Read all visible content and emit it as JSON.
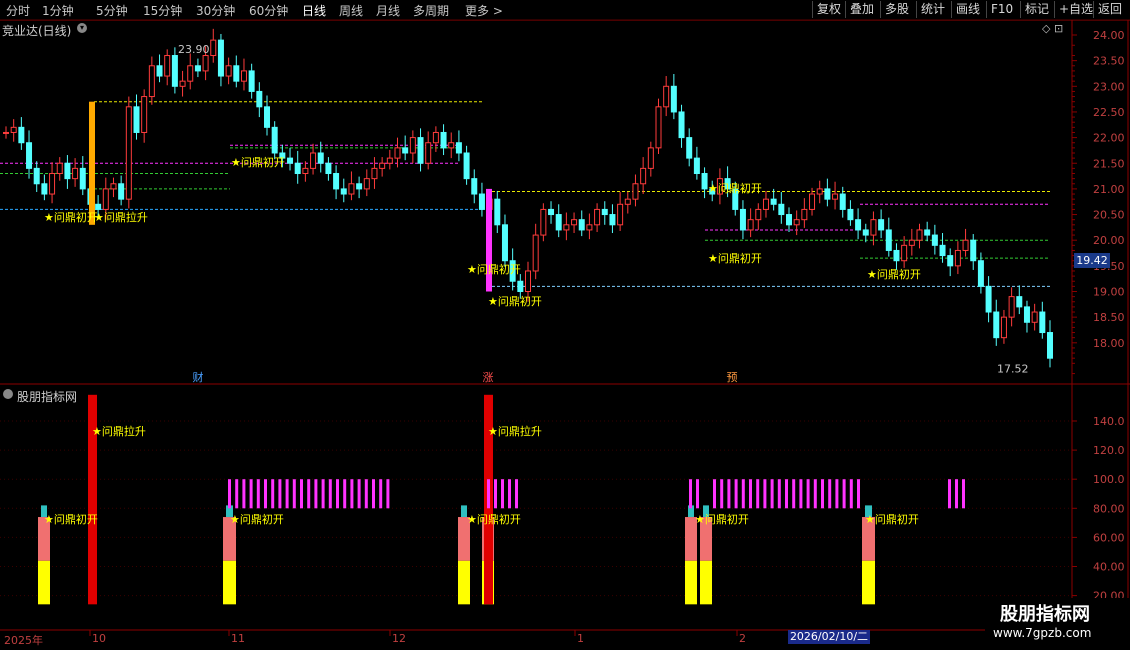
{
  "toolbar": {
    "timeframes": [
      "分时",
      "1分钟",
      "5分钟",
      "15分钟",
      "30分钟",
      "60分钟",
      "日线",
      "周线",
      "月线",
      "多周期",
      "更多 >"
    ],
    "active": "日线",
    "right_buttons": [
      "复权",
      "叠加",
      "多股",
      "统计",
      "画线",
      "F10",
      "标记",
      "+自选",
      "返回"
    ]
  },
  "main_panel": {
    "title": "竞业达(日线)",
    "high_label": "23.90",
    "low_label": "17.52",
    "current_price": "19.42",
    "y_ticks": [
      "24.00",
      "23.50",
      "23.00",
      "22.50",
      "22.00",
      "21.50",
      "21.00",
      "20.50",
      "20.00",
      "19.50",
      "19.00",
      "18.50",
      "18.00"
    ],
    "event_markers": [
      {
        "text": "财",
        "color": "#4aa0ff"
      },
      {
        "text": "涨",
        "color": "#ff5050"
      },
      {
        "text": "预",
        "color": "#ff9a40"
      }
    ],
    "signal_labels": [
      "★问鼎初开",
      "★问鼎拉升",
      "★问鼎初开",
      "★问鼎初开",
      "★问鼎初开",
      "★问鼎初开",
      "★问鼎初开"
    ]
  },
  "indicator_panel": {
    "title": "股朋指标网",
    "y_ticks": [
      "140.0",
      "120.0",
      "100.0",
      "80.00",
      "60.00",
      "40.00",
      "20.00"
    ],
    "signal_labels": [
      "★问鼎拉升",
      "★问鼎拉升",
      "★问鼎初开",
      "★问鼎初开",
      "★问鼎初开",
      "★问鼎初开",
      "★问鼎初开"
    ]
  },
  "x_axis": {
    "labels": [
      "2025年",
      "10",
      "11",
      "12",
      "1",
      "2"
    ],
    "selected_date": "2026/02/10/二"
  },
  "watermark": {
    "name": "股朋指标网",
    "url": "www.7gpzb.com"
  },
  "colors": {
    "up": "#ff3c3c",
    "down": "#54ffff",
    "magenta": "#ff33ff",
    "yellow_line": "#e8e800",
    "green_line": "#33cc33",
    "label": "#ffff00",
    "grid": "#8b0000"
  }
}
